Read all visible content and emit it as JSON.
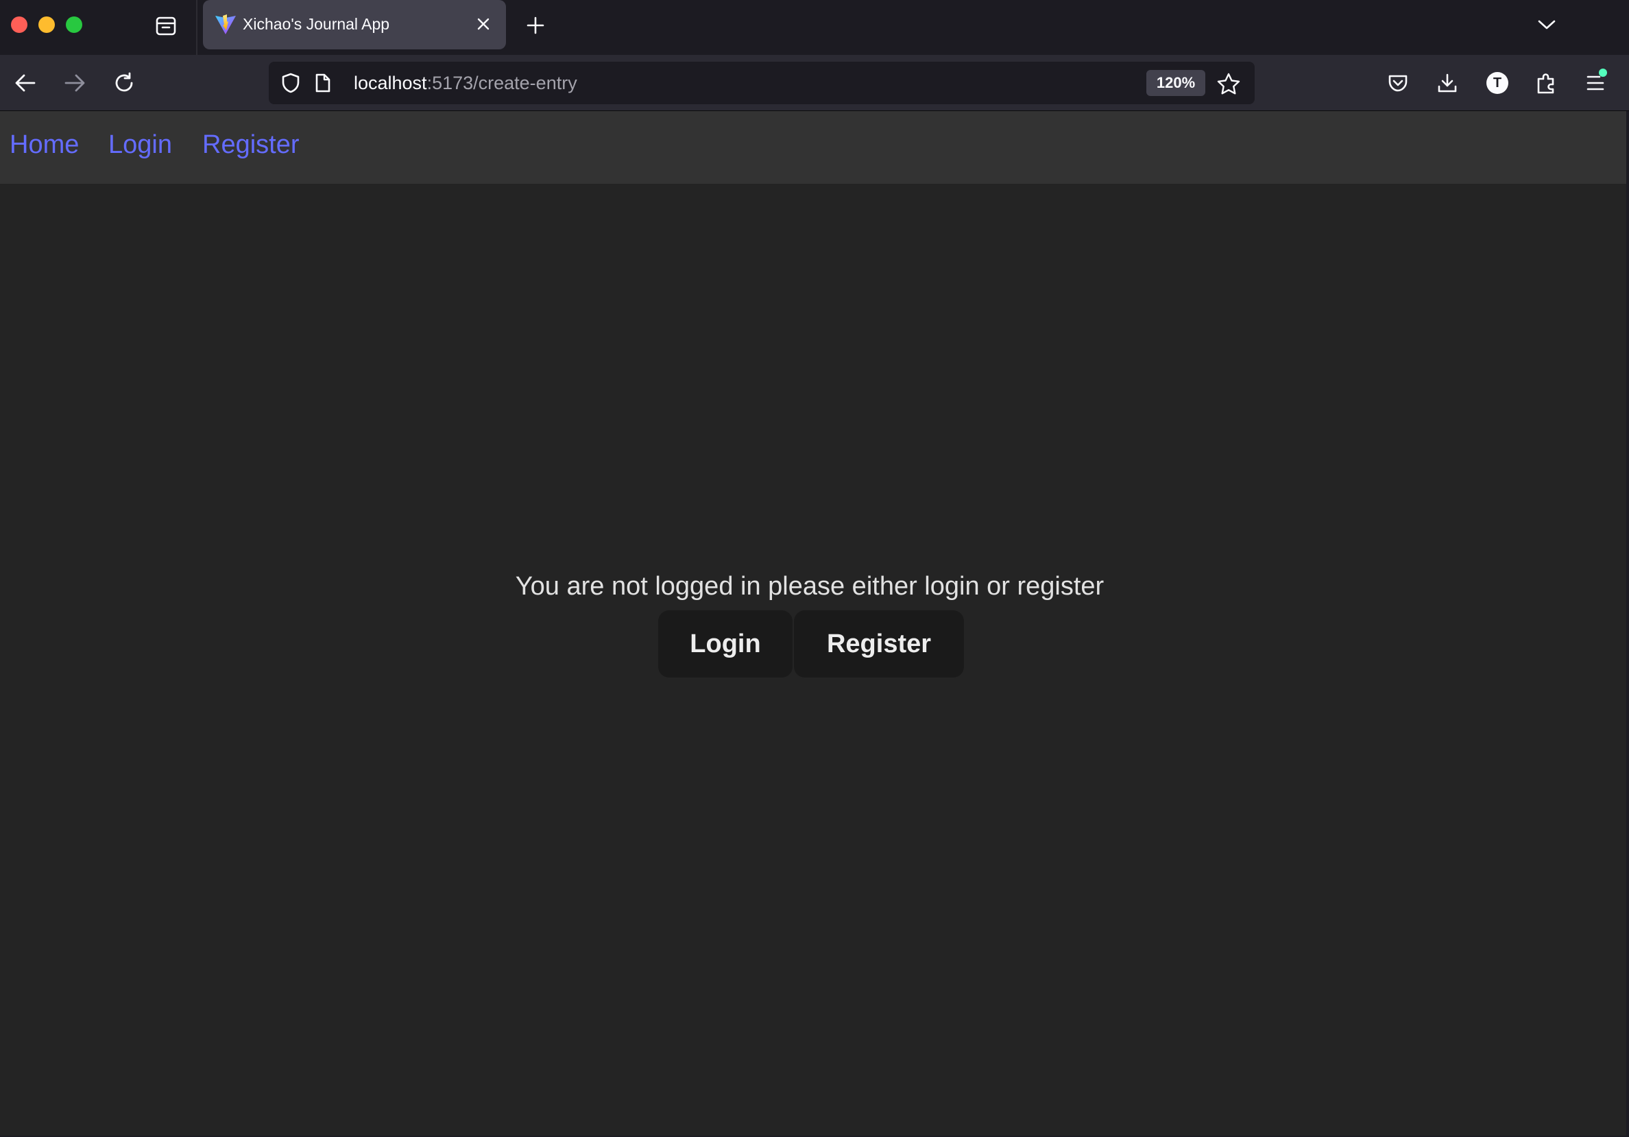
{
  "browser": {
    "tab": {
      "title": "Xichao's Journal App"
    },
    "url": {
      "host": "localhost",
      "path": ":5173/create-entry"
    },
    "zoom": "120%",
    "profile_initial": "T"
  },
  "nav": {
    "links": [
      {
        "label": "Home"
      },
      {
        "label": "Login"
      },
      {
        "label": "Register"
      }
    ],
    "link_color": "#646cff"
  },
  "main": {
    "message": "You are not logged in please either login or register",
    "login_button": "Login",
    "register_button": "Register"
  },
  "colors": {
    "page_background": "#242424",
    "navbar_background": "#333333",
    "button_background": "#1a1a1a"
  }
}
